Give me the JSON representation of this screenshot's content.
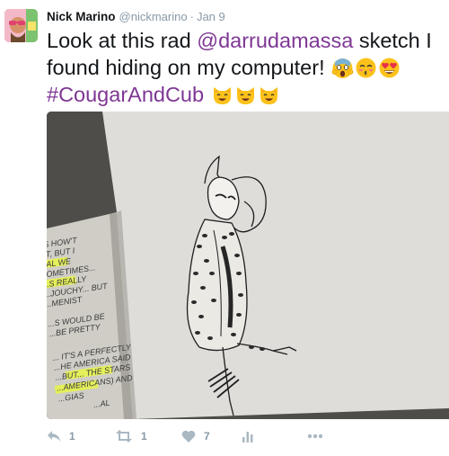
{
  "tweet": {
    "author_name": "Nick Marino",
    "author_handle": "@nickmarino",
    "separator": "·",
    "timestamp": "Jan 9",
    "text_part1": "Look at this rad ",
    "mention": "@darrudamassa",
    "text_part2": " sketch I",
    "text_line2": "found hiding on my computer! ",
    "hashtag": "#CougarAndCub",
    "emojis_line2": [
      "face-screaming-emoji",
      "kissing-face-closed-eyes-emoji",
      "heart-eyes-emoji"
    ],
    "emojis_line3": [
      "smiling-cat-emoji",
      "smiling-cat-emoji",
      "smiling-cat-emoji"
    ],
    "image_alt": "Pencil sketch in a notebook of a masked woman in a leopard-print coat",
    "notebook_notes": [
      "...S HOW'T",
      "IST, BUT I",
      "...AL WE",
      "SOMETIMES...",
      "...S REALLY",
      "...JOUCHY... BUT",
      "...MENIST",
      "...S WOULD BE",
      "...BE PRETTY",
      "... IT'S A PERFECTLY",
      "...HE AMERICA SAID",
      "...BUT... THE STARS",
      "...AMERICANS) AND",
      "...GIAS",
      "...AL"
    ]
  },
  "actions": {
    "reply_count": "1",
    "retweet_count": "1",
    "like_count": "7"
  },
  "colors": {
    "link": "#7e3794",
    "muted": "#8899a6",
    "icon": "#aab8c2"
  }
}
